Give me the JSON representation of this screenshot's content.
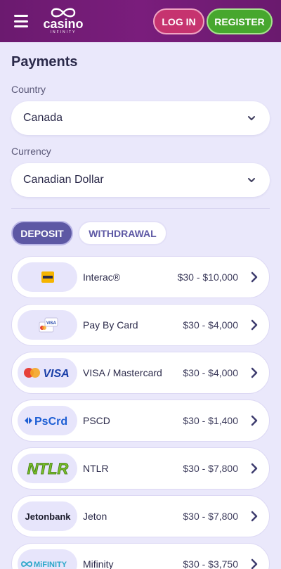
{
  "header": {
    "logo_word": "casino",
    "logo_sub": "INFINITY",
    "login_label": "LOG IN",
    "register_label": "REGISTER"
  },
  "page": {
    "title": "Payments",
    "country_label": "Country",
    "country_value": "Canada",
    "currency_label": "Currency",
    "currency_value": "Canadian Dollar"
  },
  "tabs": {
    "deposit": "DEPOSIT",
    "withdrawal": "WITHDRAWAL",
    "active": "deposit"
  },
  "methods": [
    {
      "name": "Interac®",
      "range": "$30 - $10,000",
      "logo_text": "Interac"
    },
    {
      "name": "Pay By Card",
      "range": "$30 - $4,000",
      "logo_text": "VISA"
    },
    {
      "name": "VISA / Mastercard",
      "range": "$30 - $4,000",
      "logo_text": "VISA"
    },
    {
      "name": "PSCD",
      "range": "$30 - $1,400",
      "logo_text": "PsCrd"
    },
    {
      "name": "NTLR",
      "range": "$30 - $7,800",
      "logo_text": "NTLR"
    },
    {
      "name": "Jeton",
      "range": "$30 - $7,800",
      "logo_text": "Jetonbank"
    },
    {
      "name": "Mifinity",
      "range": "$30 - $3,750",
      "logo_text": "MiFINITY"
    }
  ],
  "colors": {
    "header": "#7a1d7c",
    "login": "#c6336f",
    "register": "#47a72e",
    "accent": "#5d58a4",
    "background": "#eae8fb"
  }
}
